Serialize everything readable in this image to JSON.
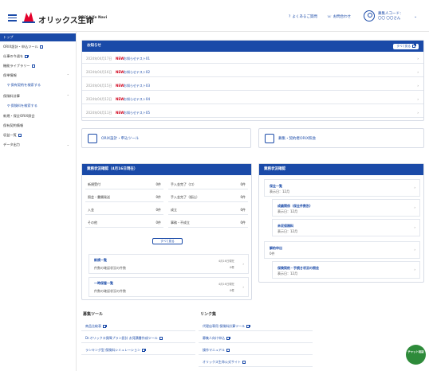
{
  "header": {
    "brand": "オリックス生命",
    "brand_sub": "ORIX Life Navi",
    "link_faq": "よくあるご質問",
    "link_contact": "お問合わせ",
    "user_line1": "募集人コード：",
    "user_line2": "〇〇 〇〇さん",
    "accent": "#1a4aa8"
  },
  "sidebar": {
    "items": [
      {
        "label": "トップ"
      },
      {
        "label": "ORIX設計・申込ツール"
      },
      {
        "label": "仕事の今週を"
      },
      {
        "label": "機能ライブラリー"
      },
      {
        "label": "保単情報"
      },
      {
        "label": "保有契約を検索する"
      },
      {
        "label": "保険料計算"
      },
      {
        "label": "保険料を検索する"
      },
      {
        "label": "新規・保全ORIX照会"
      },
      {
        "label": "保有契約情報"
      },
      {
        "label": "収益一覧"
      },
      {
        "label": "データ出力"
      }
    ]
  },
  "notices": {
    "title": "お知らせ",
    "all_button": "すべて見る",
    "rows": [
      {
        "date": "2024年04月17日",
        "new": "NEW",
        "title": "お知らせテスト01"
      },
      {
        "date": "2024年04月16日",
        "new": "NEW",
        "title": "お知らせテスト02"
      },
      {
        "date": "2024年04月15日",
        "new": "NEW",
        "title": "お知らせテスト03"
      },
      {
        "date": "2024年04月12日",
        "new": "NEW",
        "title": "お知らせテスト04"
      },
      {
        "date": "2024年04月11日",
        "new": "NEW",
        "title": "お知らせテスト05"
      }
    ]
  },
  "tools": {
    "tile1": "ORIX設計・申込ツール",
    "tile2": "募集・契約者ORIX照会"
  },
  "stats": {
    "title": "業務状況確認（4月16日現在）",
    "more": "すべて見る",
    "left": [
      {
        "k": "新規受付",
        "v": "0件"
      },
      {
        "k": "照会・書類発送",
        "v": "0件"
      },
      {
        "k": "入金",
        "v": "0件"
      },
      {
        "k": "その他",
        "v": "0件"
      }
    ],
    "right": [
      {
        "k": "手入金完了（口）",
        "v": "0件"
      },
      {
        "k": "手入金完了（振込）",
        "v": "0件"
      },
      {
        "k": "成立",
        "v": "0件"
      },
      {
        "k": "事務・不成立",
        "v": "0件"
      }
    ],
    "box1": {
      "title": "新規一覧",
      "sub": "件数の確認状況の件数",
      "r1": "4月16日現在",
      "r2": "0件"
    },
    "box2": {
      "title": "一時保管一覧",
      "sub": "件数の確認状況の件数",
      "r1": "4月16日現在",
      "r2": "0件"
    }
  },
  "right_panel": {
    "title": "業務状況確認",
    "items": [
      {
        "title": "保全一覧",
        "sub": "表示日：12月"
      },
      {
        "title": "成績関係（保全件数別）",
        "sub": "表示日：12月"
      },
      {
        "title": "未収保険料",
        "sub": "表示日：12月"
      },
      {
        "title": "解約申出",
        "sub": "0件"
      },
      {
        "title": "保険契約・手続き状況の照会",
        "sub": "表示日：12月"
      }
    ]
  },
  "bottom_left": {
    "title": "募集ツール",
    "links": [
      {
        "label": "商品比較表"
      },
      {
        "label": "Dr.オリックス保障プラン設計 お見積書作成ツール"
      },
      {
        "label": "ランキング型 保険料シミュレーション"
      }
    ]
  },
  "bottom_right": {
    "title": "リンク集",
    "links": [
      {
        "label": "代理店専用 保険料計算ツール"
      },
      {
        "label": "募集人向け申込"
      },
      {
        "label": "操作マニュアル"
      },
      {
        "label": "オリックス生命公式サイト"
      }
    ]
  },
  "badge": {
    "text": "チャット相談"
  }
}
